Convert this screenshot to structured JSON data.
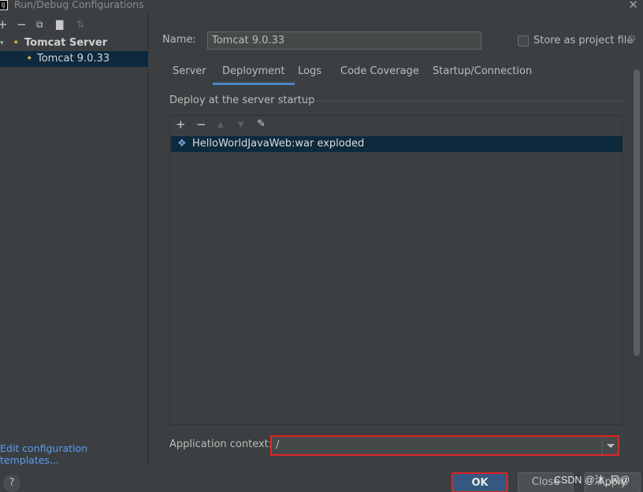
{
  "window": {
    "title": "Run/Debug Configurations",
    "app_icon": "intellij-icon",
    "close_icon": "close-icon"
  },
  "left_toolbar": {
    "add": "+",
    "remove": "−",
    "copy_icon": "copy-icon",
    "folder_icon": "folder-icon",
    "sort_icon": "sort-icon"
  },
  "tree": {
    "group_label": "Tomcat Server",
    "item_label": "Tomcat 9.0.33"
  },
  "left_footer": {
    "edit_templates": "Edit configuration templates..."
  },
  "form": {
    "name_label": "Name:",
    "name_value": "Tomcat 9.0.33",
    "store_label": "Store as project file",
    "store_checked": false
  },
  "tabs": [
    "Server",
    "Deployment",
    "Logs",
    "Code Coverage",
    "Startup/Connection"
  ],
  "active_tab": "Deployment",
  "deployment": {
    "section_label": "Deploy at the server startup",
    "toolbar": {
      "add": "+",
      "remove": "−",
      "up": "▲",
      "down": "▼",
      "edit_icon": "pencil-icon"
    },
    "artifacts": [
      "HelloWorldJavaWeb:war exploded"
    ],
    "context_label": "Application context:",
    "context_value": "/"
  },
  "buttons": {
    "help": "?",
    "ok": "OK",
    "close": "Close",
    "apply": "Apply"
  },
  "watermark": "CSDN @沐_风@",
  "colors": {
    "background": "#3c3f41",
    "selection": "#0d293e",
    "accent": "#4a88c7",
    "link": "#589df6",
    "highlight_border": "#e02424",
    "ok_button": "#365880"
  }
}
